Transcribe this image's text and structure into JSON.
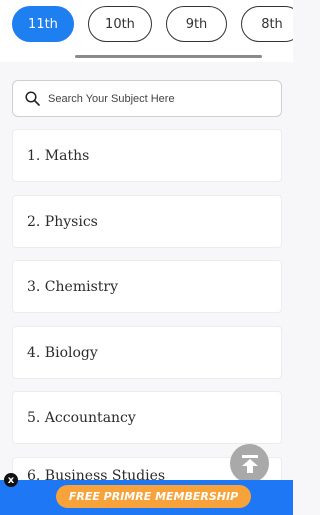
{
  "grade_tabs": [
    "11th",
    "10th",
    "9th",
    "8th"
  ],
  "active_tab": "11th",
  "search": {
    "placeholder": "Search Your Subject Here",
    "value": ""
  },
  "subjects": [
    "1. Maths",
    "2. Physics",
    "3. Chemistry",
    "4. Biology",
    "5. Accountancy",
    "6. Business Studies"
  ],
  "promo": {
    "label": "FREE PRIMRE MEMBERSHIP",
    "close": "x"
  },
  "colors": {
    "accent": "#1e7ff0",
    "promo_bar": "#1e78f5",
    "promo_button": "#f7a23a",
    "back_to_top": "#a9a9a9"
  }
}
